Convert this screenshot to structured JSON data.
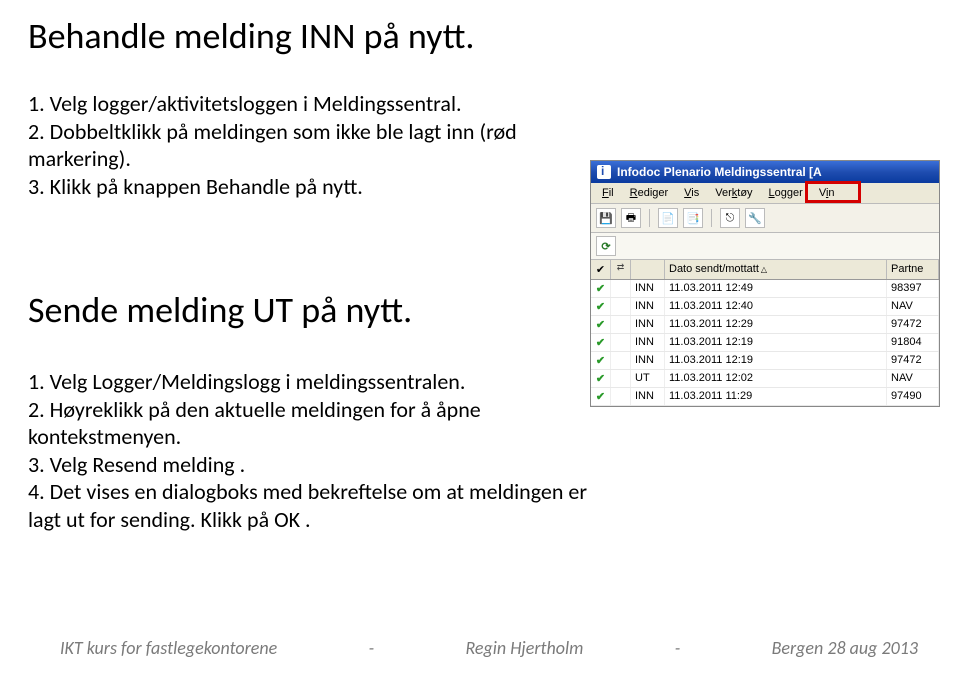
{
  "heading1": "Behandle melding INN på nytt.",
  "list1": {
    "item1": "1. Velg logger/aktivitetsloggen i Meldingssentral.",
    "item2": "2. Dobbeltklikk på meldingen som ikke ble lagt inn (rød markering).",
    "item3": "3. Klikk på knappen Behandle på nytt."
  },
  "heading2": "Sende melding UT på nytt.",
  "list2": {
    "item1": "1. Velg Logger/Meldingslogg  i meldingssentralen.",
    "item2": "2. Høyreklikk på den aktuelle meldingen for å åpne kontekstmenyen.",
    "item3": "3. Velg Resend melding .",
    "item4": "4. Det vises en dialogboks med bekreftelse om at meldingen er lagt ut for sending. Klikk på OK ."
  },
  "app": {
    "title": "Infodoc Plenario Meldingssentral    [A",
    "menus": {
      "fil": "Fil",
      "rediger": "Rediger",
      "vis": "Vis",
      "verktoy": "Verktøy",
      "logger": "Logger",
      "vinc": "Vin"
    },
    "headers": {
      "dato": "Dato sendt/mottatt",
      "partne": "Partne"
    },
    "rows": [
      {
        "dir": "INN",
        "date": "11.03.2011 12:49",
        "partner": "98397"
      },
      {
        "dir": "INN",
        "date": "11.03.2011 12:40",
        "partner": "NAV"
      },
      {
        "dir": "INN",
        "date": "11.03.2011 12:29",
        "partner": "97472"
      },
      {
        "dir": "INN",
        "date": "11.03.2011 12:19",
        "partner": "91804"
      },
      {
        "dir": "INN",
        "date": "11.03.2011 12:19",
        "partner": "97472"
      },
      {
        "dir": "UT",
        "date": "11.03.2011 12:02",
        "partner": "NAV"
      },
      {
        "dir": "INN",
        "date": "11.03.2011 11:29",
        "partner": "97490"
      }
    ]
  },
  "footer": {
    "left": "IKT kurs for fastlegekontorene",
    "sep1": "-",
    "mid": "Regin Hjertholm",
    "sep2": "-",
    "right": "Bergen  28 aug 2013"
  }
}
